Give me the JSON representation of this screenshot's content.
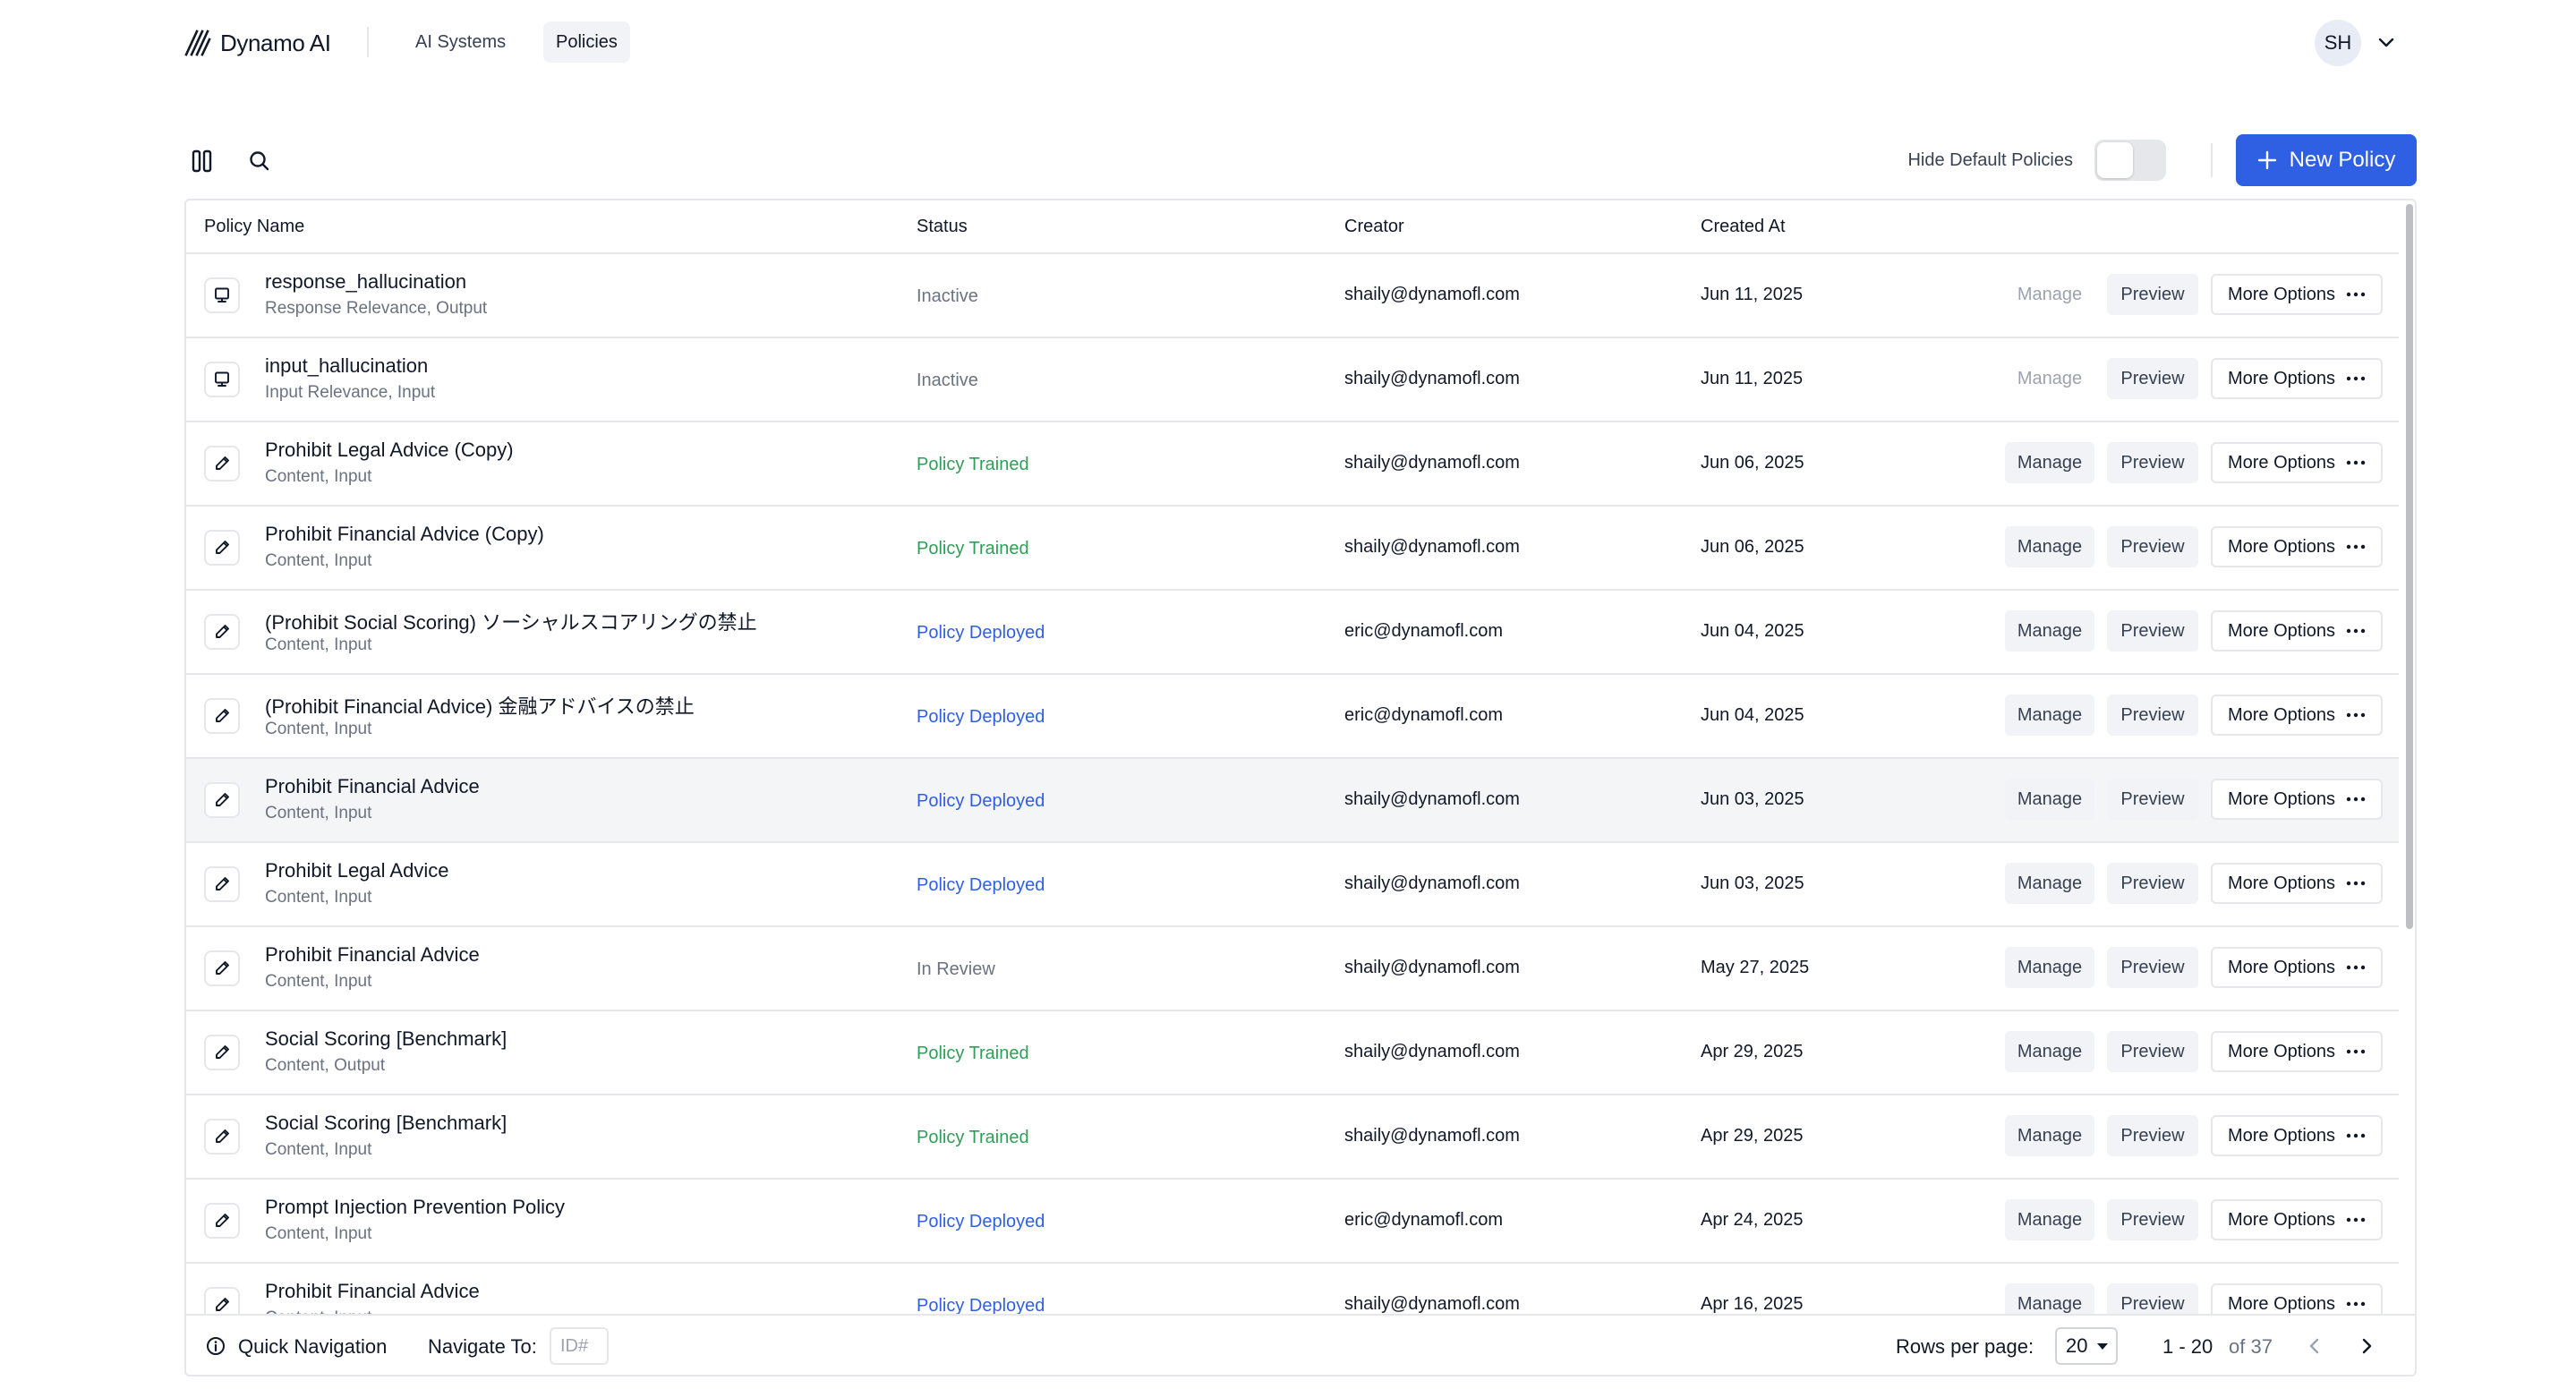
{
  "brand": {
    "name": "Dynamo AI"
  },
  "nav": {
    "tabs": [
      "AI Systems",
      "Policies"
    ],
    "active": "Policies"
  },
  "user": {
    "initials": "SH"
  },
  "toolbar": {
    "hide_default_label": "Hide Default Policies",
    "hide_default_on": false,
    "new_policy_label": "New Policy"
  },
  "table": {
    "columns": {
      "name": "Policy Name",
      "status": "Status",
      "creator": "Creator",
      "created": "Created At"
    },
    "actions": {
      "manage": "Manage",
      "preview": "Preview",
      "more": "More Options"
    },
    "rows": [
      {
        "name": "response_hallucination",
        "sub": "Response Relevance, Output",
        "status": "Inactive",
        "creator": "shaily@dynamofl.com",
        "created": "Jun 11, 2025",
        "icon": "message-icon"
      },
      {
        "name": "input_hallucination",
        "sub": "Input Relevance, Input",
        "status": "Inactive",
        "creator": "shaily@dynamofl.com",
        "created": "Jun 11, 2025",
        "icon": "message-icon"
      },
      {
        "name": "Prohibit Legal Advice (Copy)",
        "sub": "Content, Input",
        "status": "Policy Trained",
        "creator": "shaily@dynamofl.com",
        "created": "Jun 06, 2025",
        "icon": "pencil-icon"
      },
      {
        "name": "Prohibit Financial Advice (Copy)",
        "sub": "Content, Input",
        "status": "Policy Trained",
        "creator": "shaily@dynamofl.com",
        "created": "Jun 06, 2025",
        "icon": "pencil-icon"
      },
      {
        "name": "(Prohibit Social Scoring) ソーシャルスコアリングの禁止",
        "sub": "Content, Input",
        "status": "Policy Deployed",
        "creator": "eric@dynamofl.com",
        "created": "Jun 04, 2025",
        "icon": "pencil-icon"
      },
      {
        "name": "(Prohibit Financial Advice) 金融アドバイスの禁止",
        "sub": "Content, Input",
        "status": "Policy Deployed",
        "creator": "eric@dynamofl.com",
        "created": "Jun 04, 2025",
        "icon": "pencil-icon"
      },
      {
        "name": "Prohibit Financial Advice",
        "sub": "Content, Input",
        "status": "Policy Deployed",
        "creator": "shaily@dynamofl.com",
        "created": "Jun 03, 2025",
        "icon": "pencil-icon"
      },
      {
        "name": "Prohibit Legal Advice",
        "sub": "Content, Input",
        "status": "Policy Deployed",
        "creator": "shaily@dynamofl.com",
        "created": "Jun 03, 2025",
        "icon": "pencil-icon"
      },
      {
        "name": "Prohibit Financial Advice",
        "sub": "Content, Input",
        "status": "In Review",
        "creator": "shaily@dynamofl.com",
        "created": "May 27, 2025",
        "icon": "pencil-icon"
      },
      {
        "name": "Social Scoring [Benchmark]",
        "sub": "Content, Output",
        "status": "Policy Trained",
        "creator": "shaily@dynamofl.com",
        "created": "Apr 29, 2025",
        "icon": "pencil-icon"
      },
      {
        "name": "Social Scoring [Benchmark]",
        "sub": "Content, Input",
        "status": "Policy Trained",
        "creator": "shaily@dynamofl.com",
        "created": "Apr 29, 2025",
        "icon": "pencil-icon"
      },
      {
        "name": "Prompt Injection Prevention Policy",
        "sub": "Content, Input",
        "status": "Policy Deployed",
        "creator": "eric@dynamofl.com",
        "created": "Apr 24, 2025",
        "icon": "pencil-icon"
      },
      {
        "name": "Prohibit Financial Advice",
        "sub": "Content, Input",
        "status": "Policy Deployed",
        "creator": "shaily@dynamofl.com",
        "created": "Apr 16, 2025",
        "icon": "pencil-icon"
      }
    ]
  },
  "footer": {
    "quick_nav_label": "Quick Navigation",
    "navigate_to_label": "Navigate To:",
    "id_placeholder": "ID#",
    "rows_per_page_label": "Rows per page:",
    "rows_per_page_value": "20",
    "range": "1 - 20",
    "total": "of 37"
  },
  "colors": {
    "accent": "#2f5fe3",
    "trained": "#2f9e57",
    "muted": "#6b7280"
  }
}
